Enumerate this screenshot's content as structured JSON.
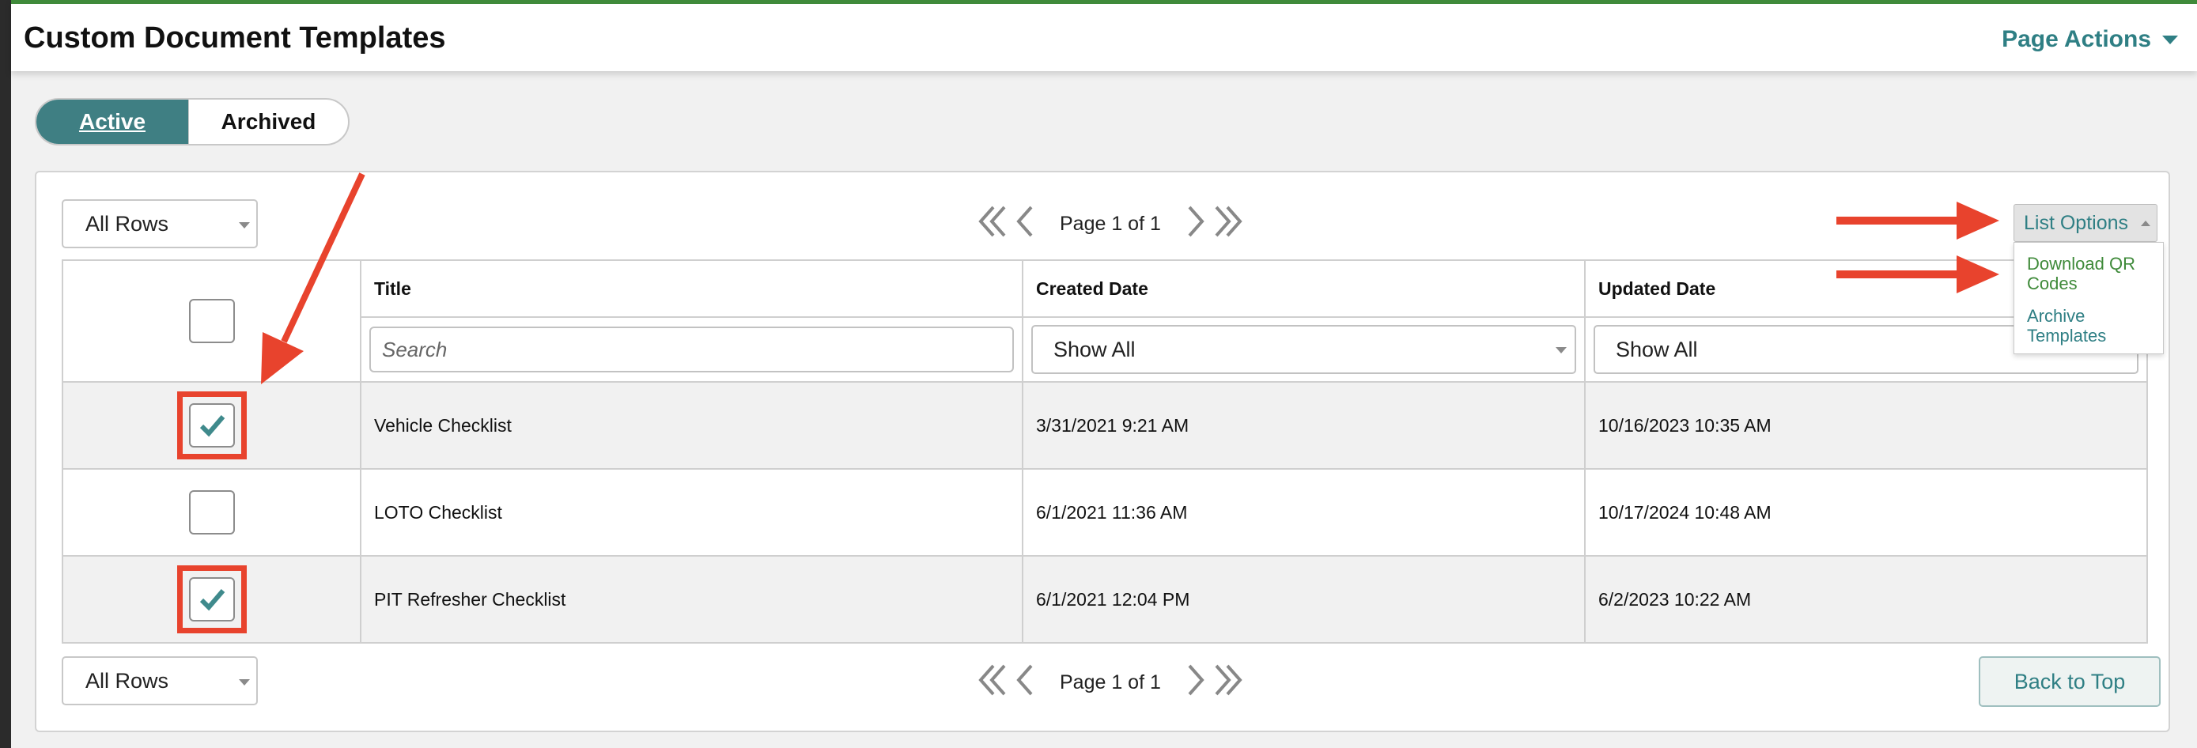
{
  "header": {
    "title": "Custom Document Templates",
    "page_actions": "Page Actions"
  },
  "tabs": [
    {
      "label": "Active",
      "selected": true
    },
    {
      "label": "Archived",
      "selected": false
    }
  ],
  "toolbar": {
    "rows_select": "All Rows",
    "pager_text": "Page 1 of 1",
    "list_options": "List Options",
    "list_options_menu": [
      "Download QR Codes",
      "Archive Templates"
    ]
  },
  "table": {
    "columns": [
      "Title",
      "Created Date",
      "Updated Date"
    ],
    "filters": {
      "title_placeholder": "Search",
      "created": "Show All",
      "updated": "Show All"
    },
    "rows": [
      {
        "title": "Vehicle Checklist",
        "created": "3/31/2021 9:21 AM",
        "updated": "10/16/2023 10:35 AM",
        "checked": true
      },
      {
        "title": "LOTO Checklist",
        "created": "6/1/2021 11:36 AM",
        "updated": "10/17/2024 10:48 AM",
        "checked": false
      },
      {
        "title": "PIT Refresher Checklist",
        "created": "6/1/2021 12:04 PM",
        "updated": "6/2/2023 10:22 AM",
        "checked": true
      }
    ]
  },
  "footer": {
    "rows_select": "All Rows",
    "pager_text": "Page 1 of 1",
    "back_to_top": "Back to Top"
  },
  "colors": {
    "accent": "#2f7f84",
    "annotation": "#e8432d",
    "green": "#3f8a3a"
  },
  "icons": [
    "chevron-double-left-icon",
    "chevron-left-icon",
    "chevron-right-icon",
    "chevron-double-right-icon",
    "check-icon",
    "caret-down-icon"
  ]
}
